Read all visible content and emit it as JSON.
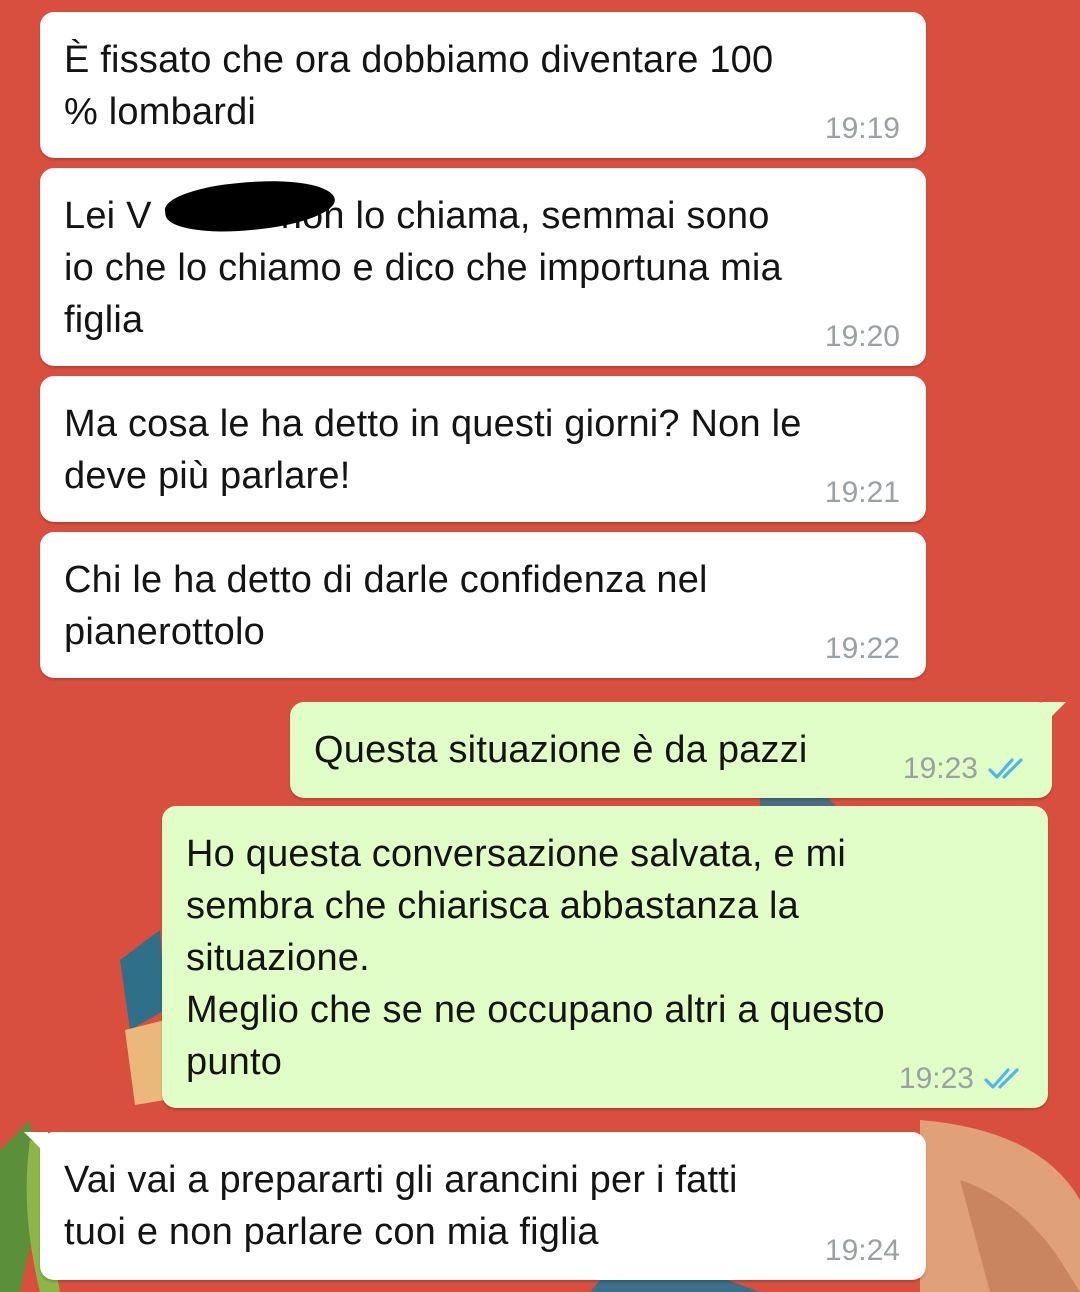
{
  "wallpaper": {
    "background_color": "#d94f3d"
  },
  "messages": [
    {
      "direction": "in",
      "text": "È fissato che ora dobbiamo diventare 100\n% lombardi",
      "time": "19:19"
    },
    {
      "direction": "in",
      "text": "Lei V            non lo chiama, semmai sono\nio che lo chiamo e dico che importuna mia\nfiglia",
      "time": "19:20",
      "redacted": true
    },
    {
      "direction": "in",
      "text": "Ma cosa le ha detto in questi giorni? Non le\ndeve più parlare!",
      "time": "19:21"
    },
    {
      "direction": "in",
      "text": "Chi le ha detto di darle confidenza nel\npianerottolo",
      "time": "19:22"
    },
    {
      "direction": "out",
      "text": "Questa situazione è da pazzi",
      "time": "19:23",
      "status": "read",
      "status_icon": "double-check-icon",
      "status_color": "#4fb6ec"
    },
    {
      "direction": "out",
      "text": "Ho questa conversazione salvata, e mi\nsembra che chiarisca abbastanza la\nsituazione.\nMeglio che se ne occupano altri a questo\npunto",
      "time": "19:23",
      "status": "read",
      "status_icon": "double-check-icon",
      "status_color": "#4fb6ec"
    },
    {
      "direction": "in",
      "text": "Vai vai a prepararti gli arancini per i fatti\ntuoi e non parlare con mia figlia",
      "time": "19:24"
    }
  ],
  "colors": {
    "incoming_bubble": "#ffffff",
    "outgoing_bubble": "#e1fec6",
    "timestamp": "#9aa0a3",
    "read_ticks": "#4fb6ec"
  }
}
